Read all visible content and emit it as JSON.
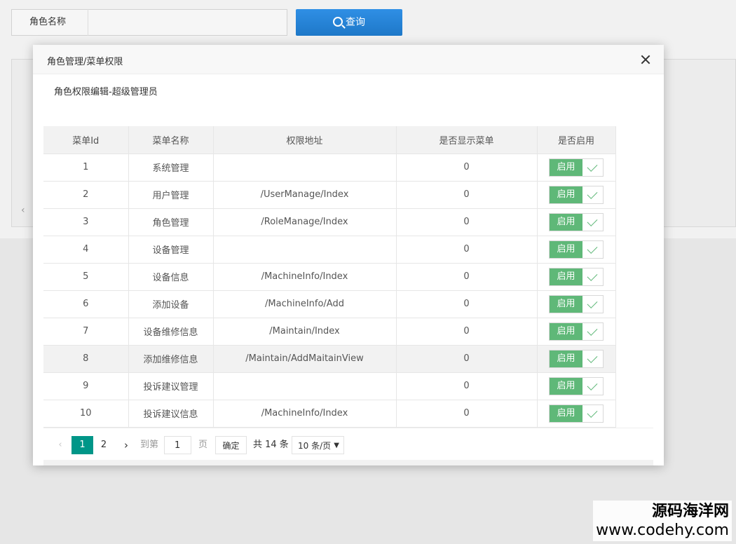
{
  "background": {
    "search_label": "角色名称",
    "query_button": "查询"
  },
  "dialog": {
    "title": "角色管理/菜单权限",
    "subtitle": "角色权限编辑-超级管理员"
  },
  "table": {
    "columns": [
      "菜单Id",
      "菜单名称",
      "权限地址",
      "是否显示菜单",
      "是否启用"
    ],
    "rows": [
      {
        "id": "1",
        "name": "系统管理",
        "url": "",
        "show": "0",
        "enabled_label": "启用"
      },
      {
        "id": "2",
        "name": "用户管理",
        "url": "/UserManage/Index",
        "show": "0",
        "enabled_label": "启用"
      },
      {
        "id": "3",
        "name": "角色管理",
        "url": "/RoleManage/Index",
        "show": "0",
        "enabled_label": "启用"
      },
      {
        "id": "4",
        "name": "设备管理",
        "url": "",
        "show": "0",
        "enabled_label": "启用"
      },
      {
        "id": "5",
        "name": "设备信息",
        "url": "/MachineInfo/Index",
        "show": "0",
        "enabled_label": "启用"
      },
      {
        "id": "6",
        "name": "添加设备",
        "url": "/MachineInfo/Add",
        "show": "0",
        "enabled_label": "启用"
      },
      {
        "id": "7",
        "name": "设备维修信息",
        "url": "/Maintain/Index",
        "show": "0",
        "enabled_label": "启用"
      },
      {
        "id": "8",
        "name": "添加维修信息",
        "url": "/Maintain/AddMaitainView",
        "show": "0",
        "enabled_label": "启用"
      },
      {
        "id": "9",
        "name": "投诉建议管理",
        "url": "",
        "show": "0",
        "enabled_label": "启用"
      },
      {
        "id": "10",
        "name": "投诉建议信息",
        "url": "/MachineInfo/Index",
        "show": "0",
        "enabled_label": "启用"
      }
    ],
    "highlighted_row": 8
  },
  "pager": {
    "pages": [
      "1",
      "2"
    ],
    "current": "1",
    "goto_label": "到第",
    "goto_value": "1",
    "page_label": "页",
    "ok_label": "确定",
    "total": "共 14 条",
    "page_size": "10 条/页"
  },
  "watermark": {
    "line1": "源码海洋网",
    "line2": "www.codehy.com"
  }
}
